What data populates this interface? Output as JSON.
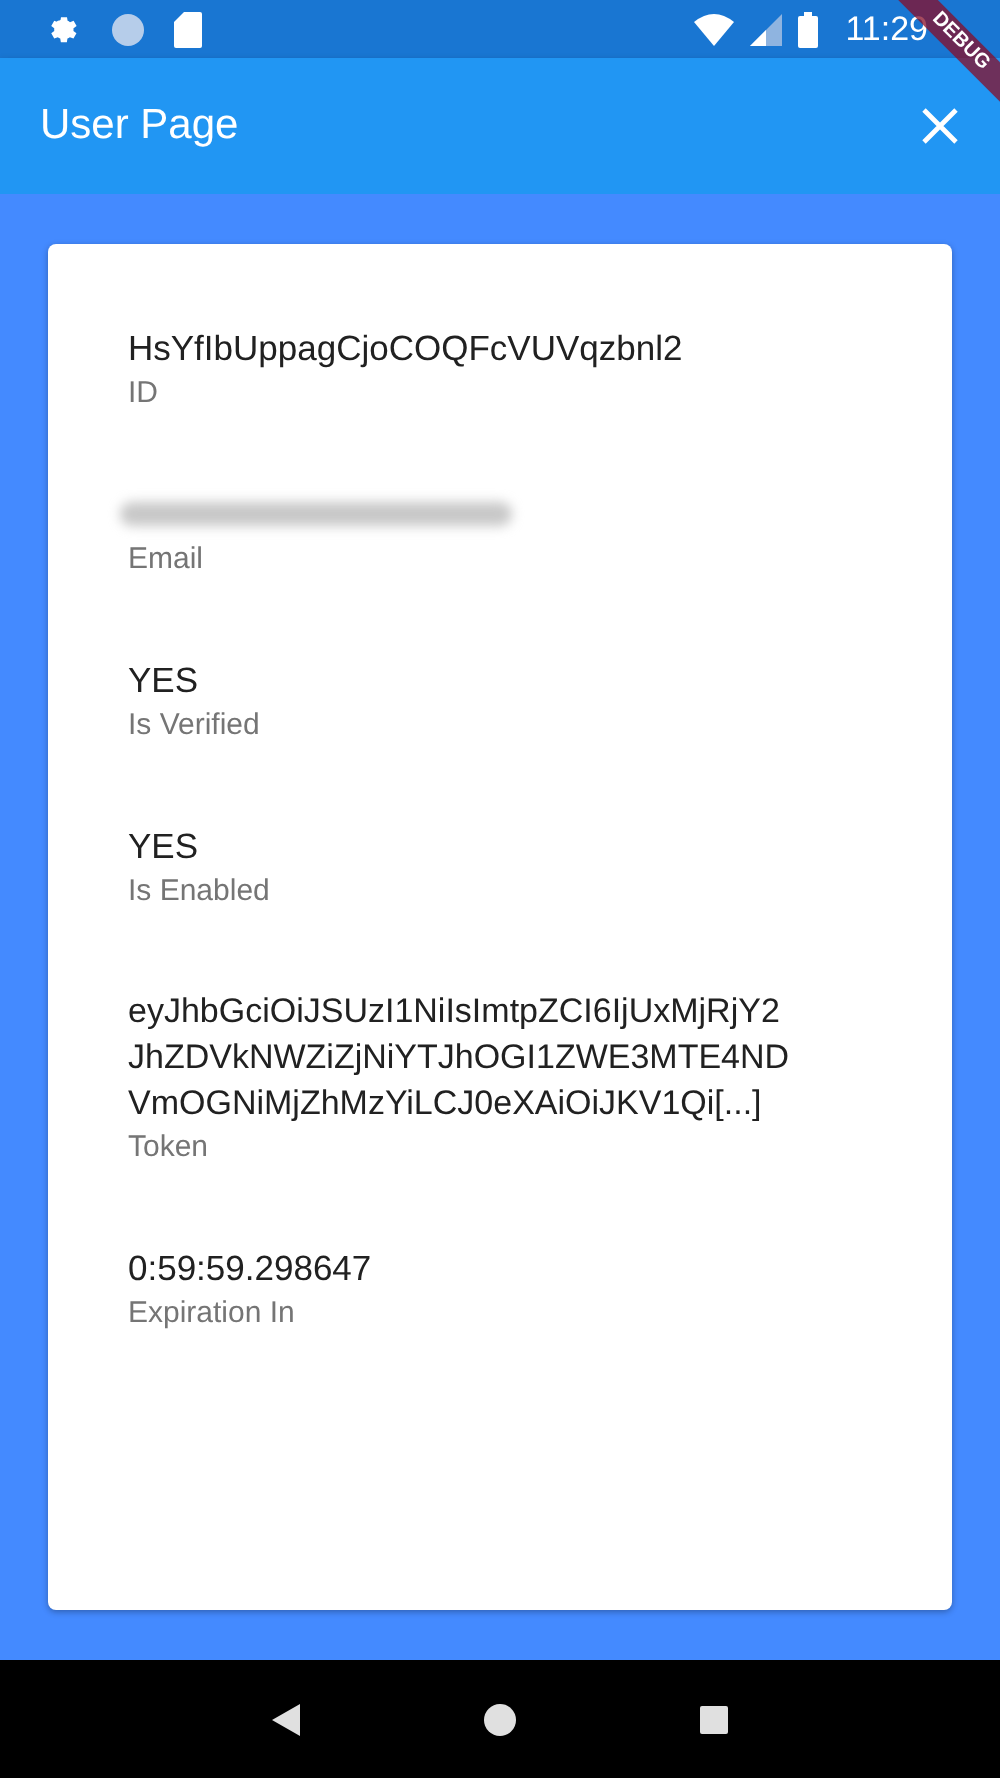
{
  "status_bar": {
    "time": "11:29"
  },
  "debug_banner": "DEBUG",
  "app_bar": {
    "title": "User Page"
  },
  "fields": [
    {
      "kind": "text",
      "value": "HsYfIbUppagCjoCOQFcVUVqzbnl2",
      "label": "ID"
    },
    {
      "kind": "blurred",
      "label": "Email"
    },
    {
      "kind": "text",
      "value": "YES",
      "label": "Is Verified"
    },
    {
      "kind": "text",
      "value": "YES",
      "label": "Is Enabled"
    },
    {
      "kind": "lines",
      "lines": [
        "eyJhbGciOiJSUzI1NiIsImtpZCI6IjUxMjRjY2",
        "JhZDVkNWZiZjNiYTJhOGI1ZWE3MTE4ND",
        "VmOGNiMjZhMzYiLCJ0eXAiOiJKV1Qi[...]"
      ],
      "label": "Token"
    },
    {
      "kind": "text",
      "value": "0:59:59.298647",
      "label": "Expiration In"
    }
  ]
}
